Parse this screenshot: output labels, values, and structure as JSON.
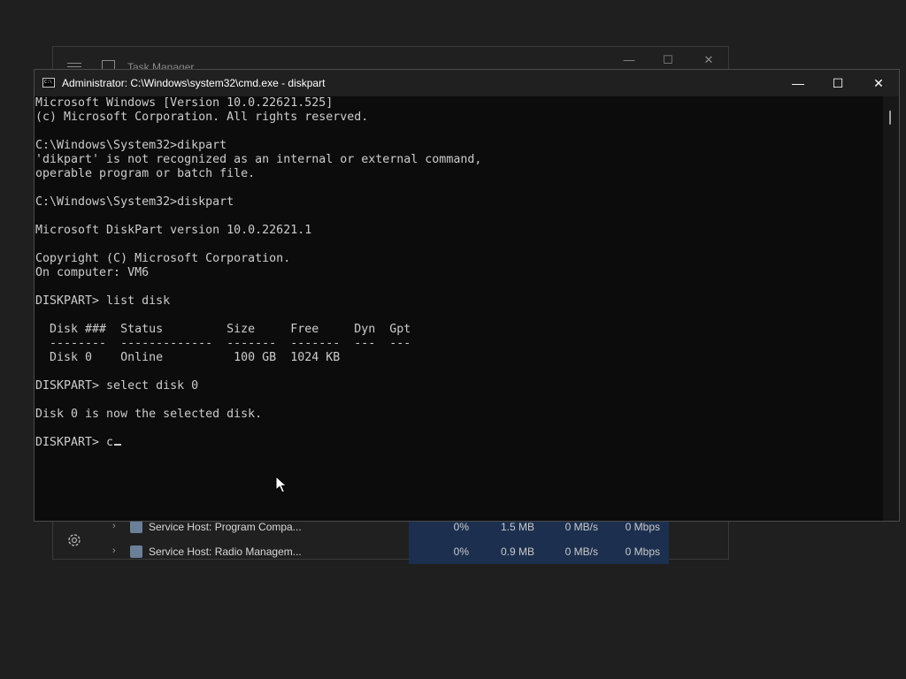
{
  "taskmanager": {
    "title": "Task Manager",
    "controls": {
      "minimize": "—",
      "maximize": "☐",
      "close": "✕"
    },
    "rows": [
      {
        "name": "Service Host: Program Compa...",
        "cpu": "0%",
        "memory": "1.5 MB",
        "disk": "0 MB/s",
        "network": "0 Mbps"
      },
      {
        "name": "Service Host: Radio Managem...",
        "cpu": "0%",
        "memory": "0.9 MB",
        "disk": "0 MB/s",
        "network": "0 Mbps"
      }
    ]
  },
  "cmd": {
    "title": "Administrator: C:\\Windows\\system32\\cmd.exe - diskpart",
    "icon_label": "C:\\",
    "controls": {
      "minimize": "—",
      "maximize": "☐",
      "close": "✕"
    },
    "output": "Microsoft Windows [Version 10.0.22621.525]\n(c) Microsoft Corporation. All rights reserved.\n\nC:\\Windows\\System32>dikpart\n'dikpart' is not recognized as an internal or external command,\noperable program or batch file.\n\nC:\\Windows\\System32>diskpart\n\nMicrosoft DiskPart version 10.0.22621.1\n\nCopyright (C) Microsoft Corporation.\nOn computer: VM6\n\nDISKPART> list disk\n\n  Disk ###  Status         Size     Free     Dyn  Gpt\n  --------  -------------  -------  -------  ---  ---\n  Disk 0    Online          100 GB  1024 KB\n\nDISKPART> select disk 0\n\nDisk 0 is now the selected disk.\n\n",
    "prompt_line": "DISKPART> c"
  },
  "colors": {
    "desktop": "#1f1f1f",
    "console_bg": "#0c0c0c",
    "console_text": "#cccccc",
    "titlebar": "#202020",
    "metric_highlight": "#1c2f4f"
  },
  "icons": {
    "taskmanager_menu": "hamburger-icon",
    "taskmanager_app": "task-manager-icon",
    "settings": "gear-icon",
    "cmd_app": "command-prompt-icon",
    "pointer": "mouse-pointer-icon"
  }
}
